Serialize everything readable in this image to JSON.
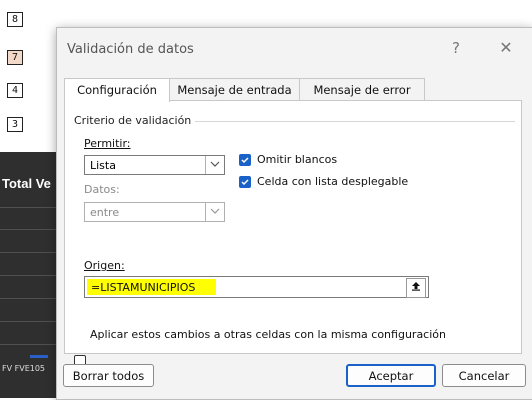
{
  "sheet": {
    "row_tags": [
      "8",
      "7",
      "4",
      "3"
    ],
    "header_fragment": "Total Ve",
    "footer_fragment": "FV FVE105"
  },
  "dialog": {
    "title": "Validación de datos",
    "help_label": "?",
    "close_label": "✕",
    "tabs": [
      "Configuración",
      "Mensaje de entrada",
      "Mensaje de error"
    ],
    "group_label": "Criterio de validación",
    "permitir": {
      "label": "Permitir:",
      "value": "Lista"
    },
    "datos": {
      "label": "Datos:",
      "value": "entre"
    },
    "omitir_blancos": {
      "label": "Omitir blancos",
      "checked": true
    },
    "celda_lista": {
      "label": "Celda con lista desplegable",
      "checked": true
    },
    "origen": {
      "label": "Origen:",
      "value": "=LISTAMUNICIPIOS"
    },
    "aplicar": {
      "label": "Aplicar estos cambios a otras celdas con la misma configuración",
      "checked": false
    },
    "buttons": {
      "borrar": "Borrar todos",
      "aceptar": "Aceptar",
      "cancelar": "Cancelar"
    }
  },
  "icons": {
    "check": "check-icon",
    "dropdown": "chevron-down-icon",
    "collapse": "range-picker-icon"
  }
}
